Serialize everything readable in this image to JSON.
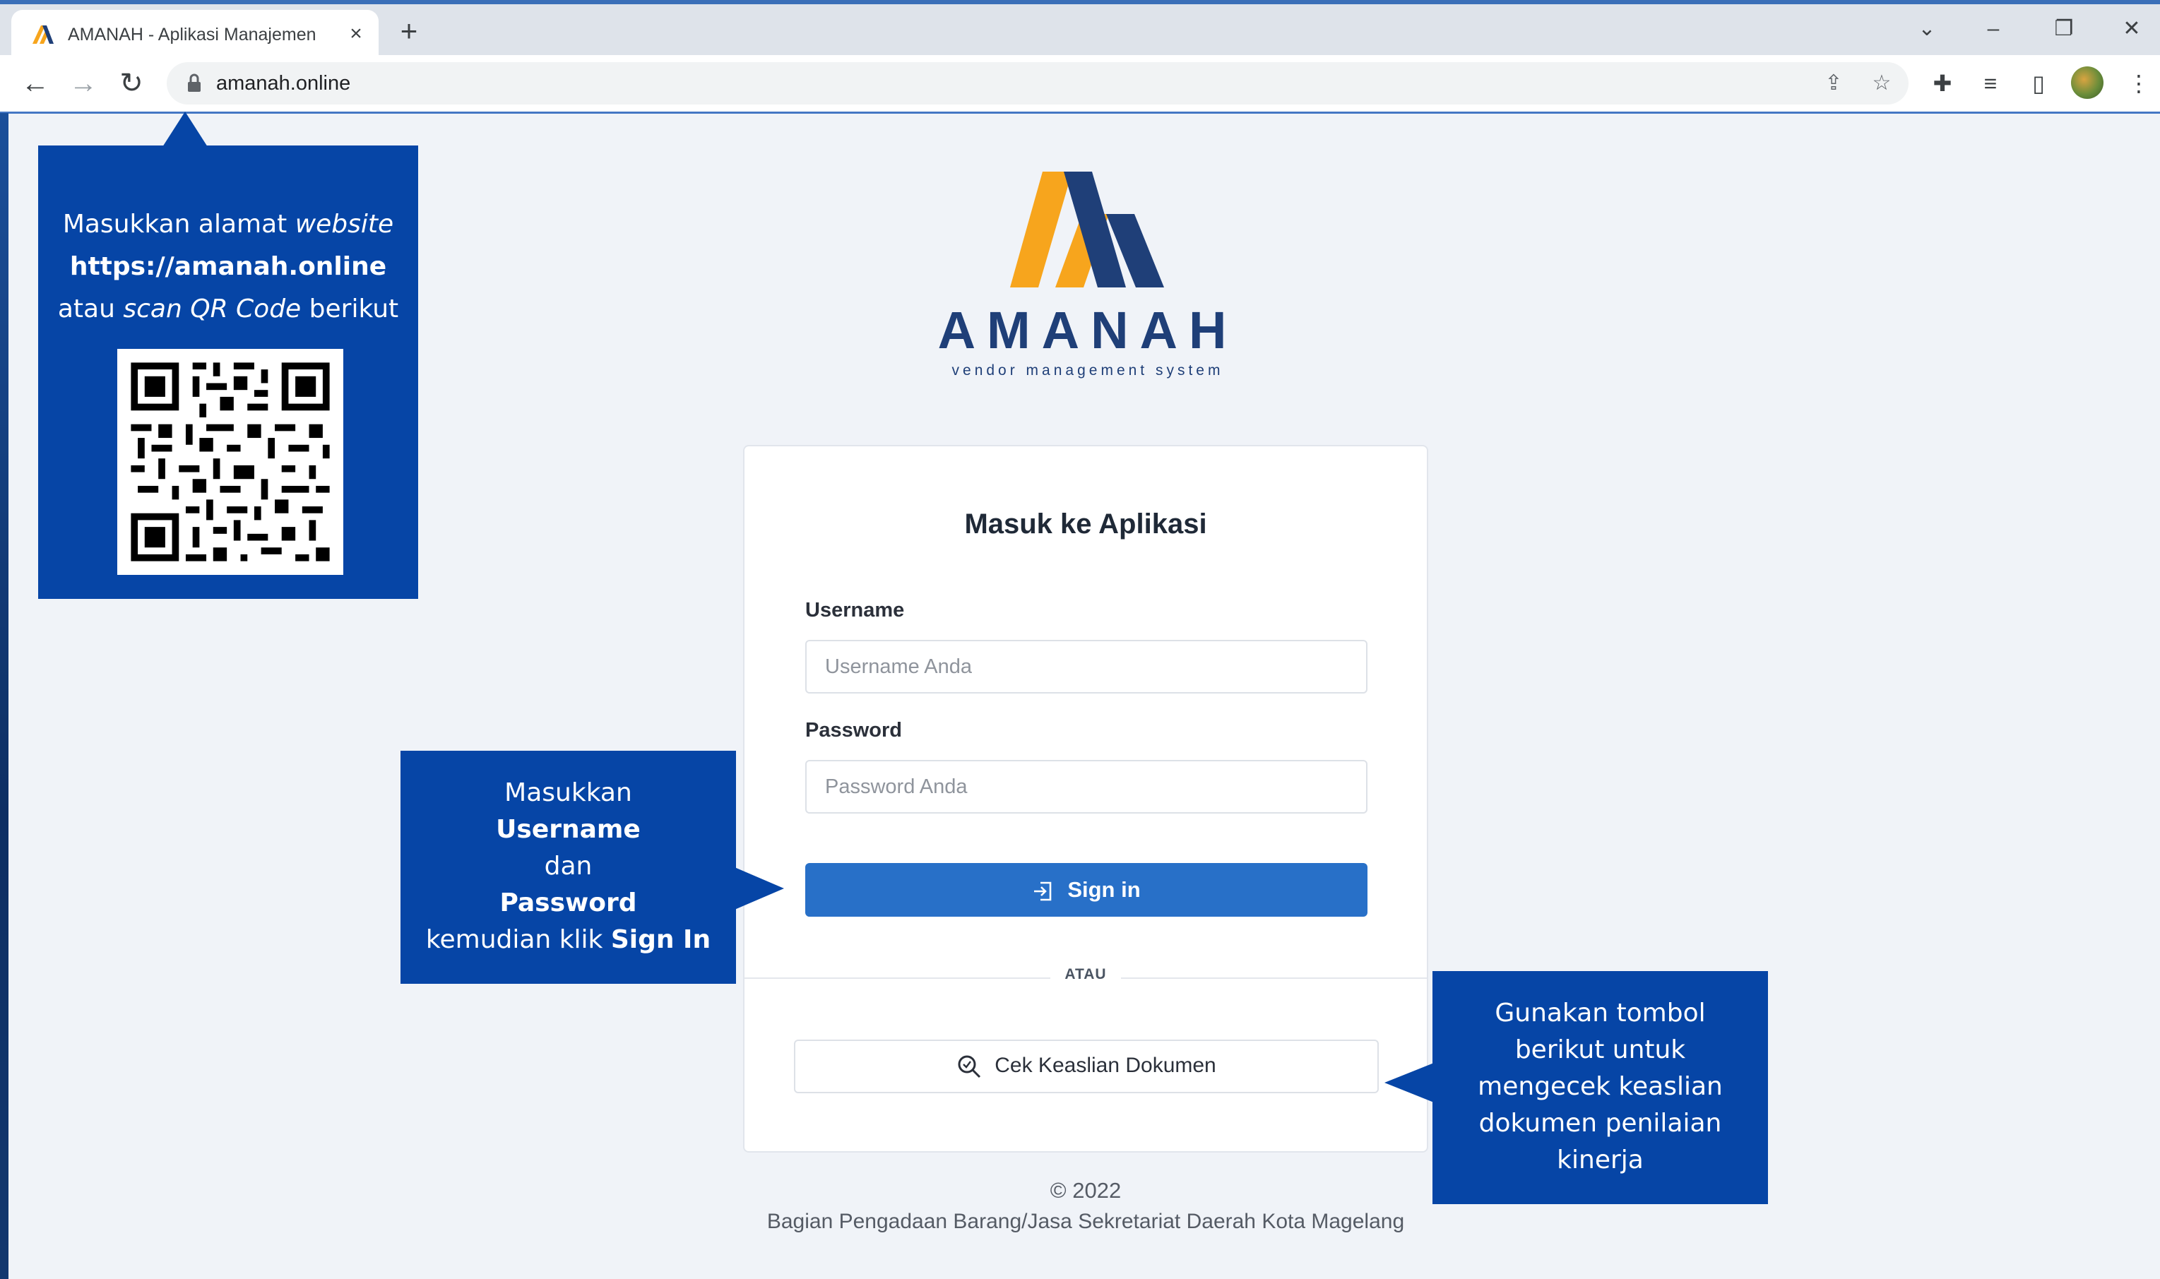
{
  "browser": {
    "tab_title": "AMANAH - Aplikasi Manajemen",
    "url": "amanah.online",
    "icons": {
      "tab_close": "close-icon",
      "new_tab": "plus-icon",
      "back": "arrow-left-icon",
      "forward": "arrow-right-icon",
      "reload": "reload-icon",
      "lock": "lock-icon",
      "share": "share-icon",
      "bookmark": "star-icon",
      "extensions": "puzzle-icon",
      "media": "media-queue-icon",
      "side_panel": "side-panel-icon",
      "menu": "kebab-menu-icon"
    }
  },
  "logo": {
    "wordmark": "AMANAH",
    "tagline": "vendor management system",
    "colors": {
      "orange": "#f7a51d",
      "navy": "#1f3f78"
    }
  },
  "login": {
    "title": "Masuk ke Aplikasi",
    "username_label": "Username",
    "username_placeholder": "Username Anda",
    "password_label": "Password",
    "password_placeholder": "Password Anda",
    "signin_label": "Sign in",
    "divider_text": "ATAU",
    "verify_label": "Cek Keaslian Dokumen",
    "accent_color": "#2870c8"
  },
  "footer": {
    "copyright": "© 2022",
    "organization": "Bagian Pengadaan Barang/Jasa Sekretariat Daerah Kota Magelang"
  },
  "callouts": {
    "address": {
      "l1_prefix": "Masukkan alamat ",
      "l1_italic": "website",
      "l2_bold": "https://amanah.online",
      "l3_prefix": "atau ",
      "l3_italic": "scan QR Code",
      "l3_suffix": " berikut"
    },
    "login": {
      "l1": "Masukkan",
      "l2_bold": "Username",
      "l3": "dan",
      "l4_bold": "Password",
      "l5_prefix": "kemudian klik ",
      "l5_bold": "Sign In"
    },
    "verify": {
      "l1": "Gunakan tombol",
      "l2": "berikut untuk",
      "l3": "mengecek keaslian",
      "l4": "dokumen penilaian",
      "l5": "kinerja"
    },
    "color": "#0645a6"
  }
}
